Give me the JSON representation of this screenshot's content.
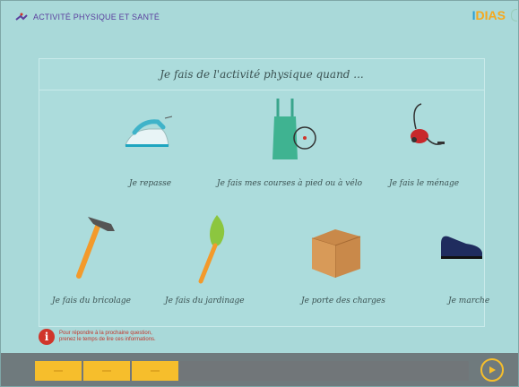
{
  "header": {
    "app_title": "ACTIVITÉ PHYSIQUE ET SANTÉ",
    "brand_first": "I",
    "brand_rest": "DIAS"
  },
  "question": "Je fais de l'activité physique quand ...",
  "items": [
    {
      "label": "Je repasse",
      "icon": "iron-icon"
    },
    {
      "label": "Je fais mes courses à pied ou à vélo",
      "icon": "shopping-bag-icon"
    },
    {
      "label": "Je fais le ménage",
      "icon": "vacuum-cleaner-icon"
    },
    {
      "label": "Je fais du bricolage",
      "icon": "hammer-icon"
    },
    {
      "label": "Je fais du jardinage",
      "icon": "trowel-icon"
    },
    {
      "label": "Je porte des charges",
      "icon": "box-icon"
    },
    {
      "label": "Je marche",
      "icon": "shoe-icon"
    }
  ],
  "info": {
    "line1": "Pour répondre à la prochaine question,",
    "line2": "prenez le temps de lire ces informations."
  },
  "progress": {
    "completed_segments": 3
  },
  "colors": {
    "accent": "#f6be2c",
    "alert": "#d0352a",
    "title": "#5b3f9e"
  }
}
